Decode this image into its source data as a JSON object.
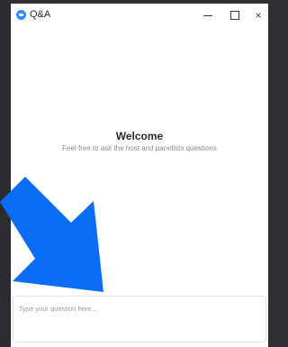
{
  "window": {
    "title": "Q&A"
  },
  "controls": {
    "minimize": "minimize",
    "maximize": "maximize",
    "close": "×"
  },
  "main": {
    "heading": "Welcome",
    "subtitle": "Feel free to ask the host and panelists questions"
  },
  "question": {
    "placeholder": "Type your question here..."
  },
  "colors": {
    "accent": "#2d8cff",
    "arrow": "#0b6cf5",
    "background": "#2f3033"
  },
  "icons": [
    "app-icon",
    "minimize-icon",
    "maximize-icon",
    "close-icon",
    "pointer-arrow-icon"
  ]
}
